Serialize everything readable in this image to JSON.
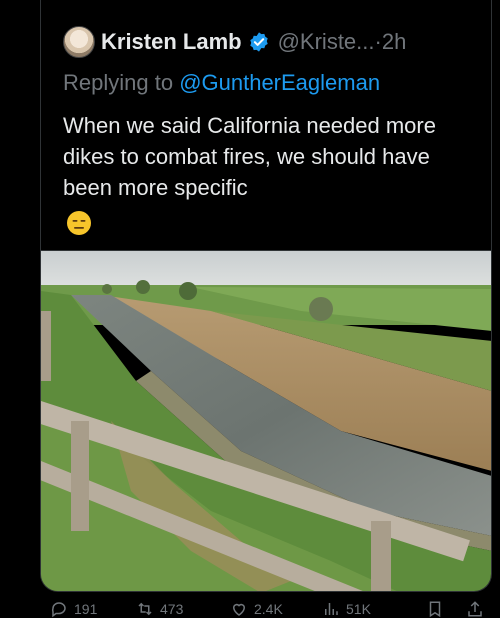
{
  "tweet": {
    "author_name": "Kristen Lamb",
    "handle": "@Kriste...",
    "separator": "·",
    "time": "2h",
    "replying_prefix": "Replying to ",
    "replying_to": "@GuntherEagleman",
    "text": "When we said California needed more dikes to combat fires, we should have been more specific",
    "emoji": "😑"
  },
  "actions": {
    "replies": "191",
    "reposts": "473",
    "likes": "2.4K",
    "views": "51K"
  },
  "colors": {
    "background": "#000000",
    "text": "#e7e9ea",
    "muted": "#71767b",
    "link": "#1d9bf0",
    "verified": "#1d9bf0"
  },
  "icons": [
    "avatar",
    "verified-badge-icon",
    "reply-icon",
    "repost-icon",
    "like-icon",
    "views-icon",
    "bookmark-icon",
    "share-icon"
  ]
}
